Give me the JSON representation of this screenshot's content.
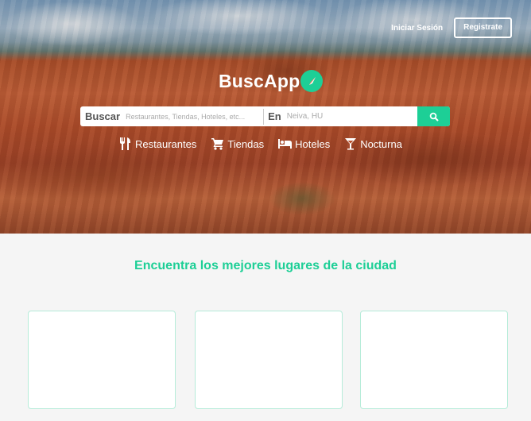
{
  "header": {
    "login_label": "Iniciar Sesión",
    "register_label": "Registrate"
  },
  "brand": {
    "name": "BuscApp",
    "accent_color": "#1dcf96"
  },
  "search": {
    "what_label": "Buscar",
    "what_placeholder": "Restaurantes, Tiendas, Hoteles, etc...",
    "where_label": "En",
    "where_placeholder": "Neiva, HU",
    "button_icon": "search-icon"
  },
  "categories": [
    {
      "label": "Restaurantes",
      "icon": "fork-knife-icon"
    },
    {
      "label": "Tiendas",
      "icon": "cart-icon"
    },
    {
      "label": "Hoteles",
      "icon": "bed-icon"
    },
    {
      "label": "Nocturna",
      "icon": "cocktail-icon"
    }
  ],
  "main": {
    "tagline": "Encuentra los mejores lugares de la ciudad"
  }
}
